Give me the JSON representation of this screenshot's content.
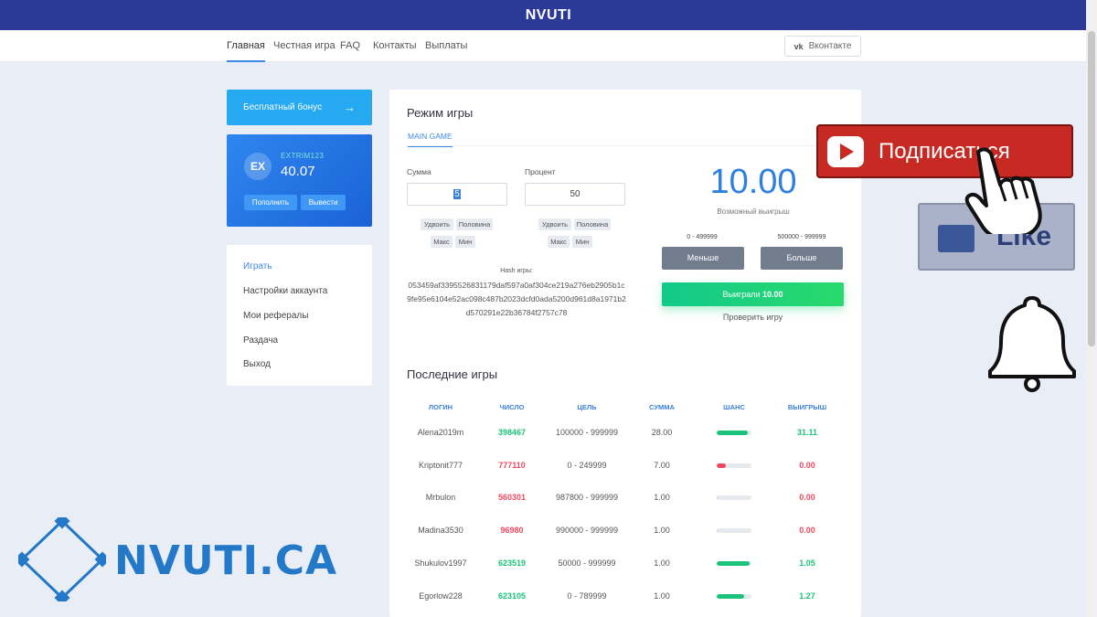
{
  "header": {
    "brand": "NVUTI"
  },
  "nav": {
    "items": [
      "Главная",
      "Честная игра",
      "FAQ",
      "Контакты",
      "Выплаты"
    ],
    "vk_label": "Вконтакте",
    "vk_icon": "vk"
  },
  "sidebar": {
    "bonus_label": "Бесплатный бонус",
    "avatar": "EX",
    "login": "EXTRIM123",
    "balance": "40.07",
    "deposit_label": "Пополнить",
    "withdraw_label": "Вывести",
    "menu": [
      "Играть",
      "Настройки аккаунта",
      "Мои рефералы",
      "Раздача",
      "Выход"
    ]
  },
  "game": {
    "title": "Режим игры",
    "tab": "MAIN GAME",
    "sum_label": "Сумма",
    "sum_value": "5",
    "percent_label": "Процент",
    "percent_value": "50",
    "double_label": "Удвоить",
    "half_label": "Половина",
    "max_label": "Макс",
    "min_label": "Мин",
    "hash_label": "Hash игры:",
    "hash": "053459af3395526831179daf597a0af304ce219a276eb2905b1c9fe95e6104e52ac098c487b2023dcfd0ada5200d961d8a1971b2d570291e22b36784f2757c78",
    "possible_win": "10.00",
    "possible_win_label": "Возможный выигрыш",
    "range_low": "0 - 499999",
    "range_high": "500000 - 999999",
    "less_label": "Меньше",
    "more_label": "Больше",
    "won_prefix": "Выиграли",
    "won_value": "10.00",
    "check_label": "Проверить игру"
  },
  "recent": {
    "title": "Последние игры",
    "columns": [
      "ЛОГИН",
      "ЧИСЛО",
      "ЦЕЛЬ",
      "СУММА",
      "ШАНС",
      "ВЫИГРЫШ"
    ],
    "rows": [
      {
        "login": "Alena2019m",
        "number": "398467",
        "target": "100000 - 999999",
        "sum": "28.00",
        "chance": 0.9,
        "win": "31.11",
        "won": true
      },
      {
        "login": "Kriptonit777",
        "number": "777110",
        "target": "0 - 249999",
        "sum": "7.00",
        "chance": 0.25,
        "win": "0.00",
        "won": false
      },
      {
        "login": "Mrbulon",
        "number": "560301",
        "target": "987800 - 999999",
        "sum": "1.00",
        "chance": 0.02,
        "win": "0.00",
        "won": false
      },
      {
        "login": "Madina3530",
        "number": "96980",
        "target": "990000 - 999999",
        "sum": "1.00",
        "chance": 0.01,
        "win": "0.00",
        "won": false
      },
      {
        "login": "Shukulov1997",
        "number": "623519",
        "target": "50000 - 999999",
        "sum": "1.00",
        "chance": 0.95,
        "win": "1.05",
        "won": true
      },
      {
        "login": "Egorlow228",
        "number": "623105",
        "target": "0 - 789999",
        "sum": "1.00",
        "chance": 0.79,
        "win": "1.27",
        "won": true
      }
    ]
  },
  "overlays": {
    "subscribe_label": "Подписаться",
    "like_label": "Like",
    "logo_text": "NVUTI.CA"
  },
  "colors": {
    "topbar": "#2d3996",
    "accent": "#3b8be6",
    "green": "#1cc37a",
    "red": "#ef4a5f"
  }
}
